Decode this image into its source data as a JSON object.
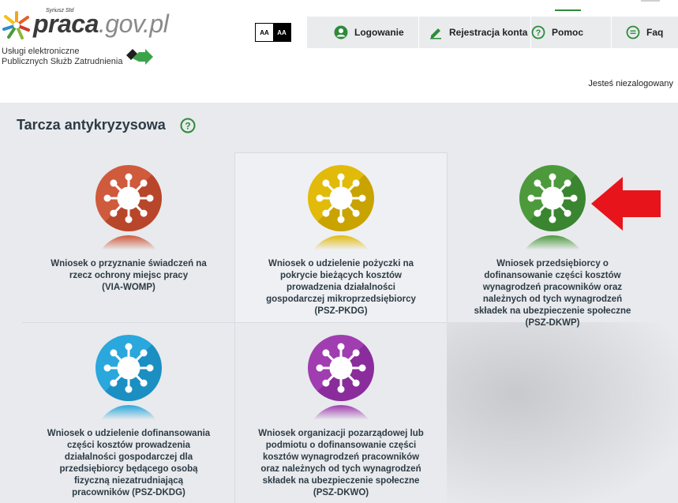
{
  "header": {
    "brand_main": "praca",
    "brand_domain": ".gov.pl",
    "brand_tag": "Syriusz Std",
    "subtitle_line1": "Usługi elektroniczne",
    "subtitle_line2": "Publicznych Służb Zatrudnienia",
    "contrast_normal": "AA",
    "contrast_high": "AA",
    "login_status": "Jesteś niezalogowany"
  },
  "nav": {
    "items": [
      {
        "label": "Logowanie",
        "icon": "user-icon"
      },
      {
        "label": "Rejestracja konta",
        "icon": "pencil-icon"
      },
      {
        "label": "Pomoc",
        "icon": "help-icon"
      },
      {
        "label": "Faq",
        "icon": "chat-icon"
      }
    ]
  },
  "section": {
    "title": "Tarcza antykryzysowa"
  },
  "tiles": [
    {
      "lines": [
        "Wniosek o przyznanie świadczeń na",
        "rzecz ochrony miejsc pracy",
        "(VIA-WOMP)"
      ],
      "color": "#cf5a3c",
      "dark": "#b8462a"
    },
    {
      "lines": [
        "Wniosek o udzielenie pożyczki na",
        "pokrycie bieżących kosztów",
        "prowadzenia działalności",
        "gospodarczej mikroprzedsiębiorcy",
        "(PSZ-PKDG)"
      ],
      "color": "#e2bb0a",
      "dark": "#c9a300"
    },
    {
      "lines": [
        "Wniosek przedsiębiorcy o",
        "dofinansowanie części kosztów",
        "wynagrodzeń pracowników oraz",
        "należnych od tych wynagrodzeń",
        "składek na ubezpieczenie społeczne",
        "(PSZ-DKWP)"
      ],
      "color": "#4c9a3c",
      "dark": "#3a8530"
    },
    {
      "lines": [
        "Wniosek o udzielenie dofinansowania",
        "części kosztów prowadzenia",
        "działalności gospodarczej dla",
        "przedsiębiorcy będącego osobą",
        "fizyczną niezatrudniającą",
        "pracowników (PSZ-DKDG)"
      ],
      "color": "#2aa7dc",
      "dark": "#1b8fc2"
    },
    {
      "lines": [
        "Wniosek organizacji pozarządowej lub",
        "podmiotu o dofinansowanie części",
        "kosztów wynagrodzeń pracowników",
        "oraz należnych od tych wynagrodzeń",
        "składek na ubezpieczenie społeczne",
        "(PSZ-DKWO)"
      ],
      "color": "#a03db0",
      "dark": "#8a2c9c"
    }
  ],
  "colors": {
    "accent_green": "#2e8b3a",
    "arrow_red": "#e8141c"
  }
}
